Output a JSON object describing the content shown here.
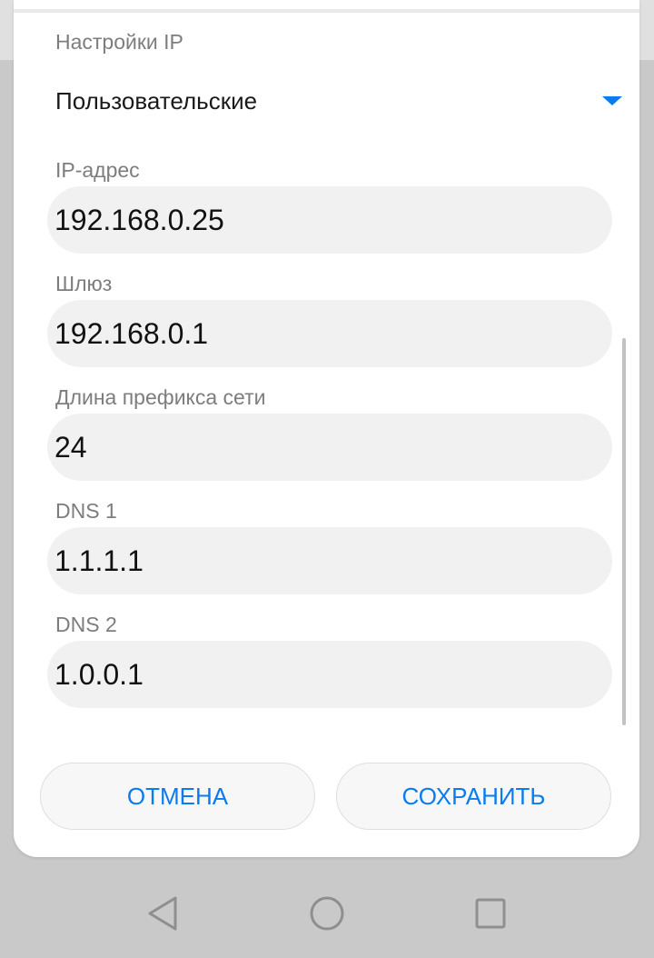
{
  "ip_settings": {
    "label": "Настройки IP",
    "selected": "Пользовательские"
  },
  "fields": [
    {
      "label": "IP-адрес",
      "value": "192.168.0.25"
    },
    {
      "label": "Шлюз",
      "value": "192.168.0.1"
    },
    {
      "label": "Длина префикса сети",
      "value": "24"
    },
    {
      "label": "DNS 1",
      "value": "1.1.1.1"
    },
    {
      "label": "DNS 2",
      "value": "1.0.0.1"
    }
  ],
  "buttons": {
    "cancel": "ОТМЕНА",
    "save": "СОХРАНИТЬ"
  },
  "colors": {
    "accent": "#0a7cf0",
    "field_background": "#f1f1f1",
    "label": "#7d7d7d"
  },
  "navigation": {
    "back_icon": "triangle-back-icon",
    "home_icon": "circle-home-icon",
    "recents_icon": "square-recents-icon"
  }
}
